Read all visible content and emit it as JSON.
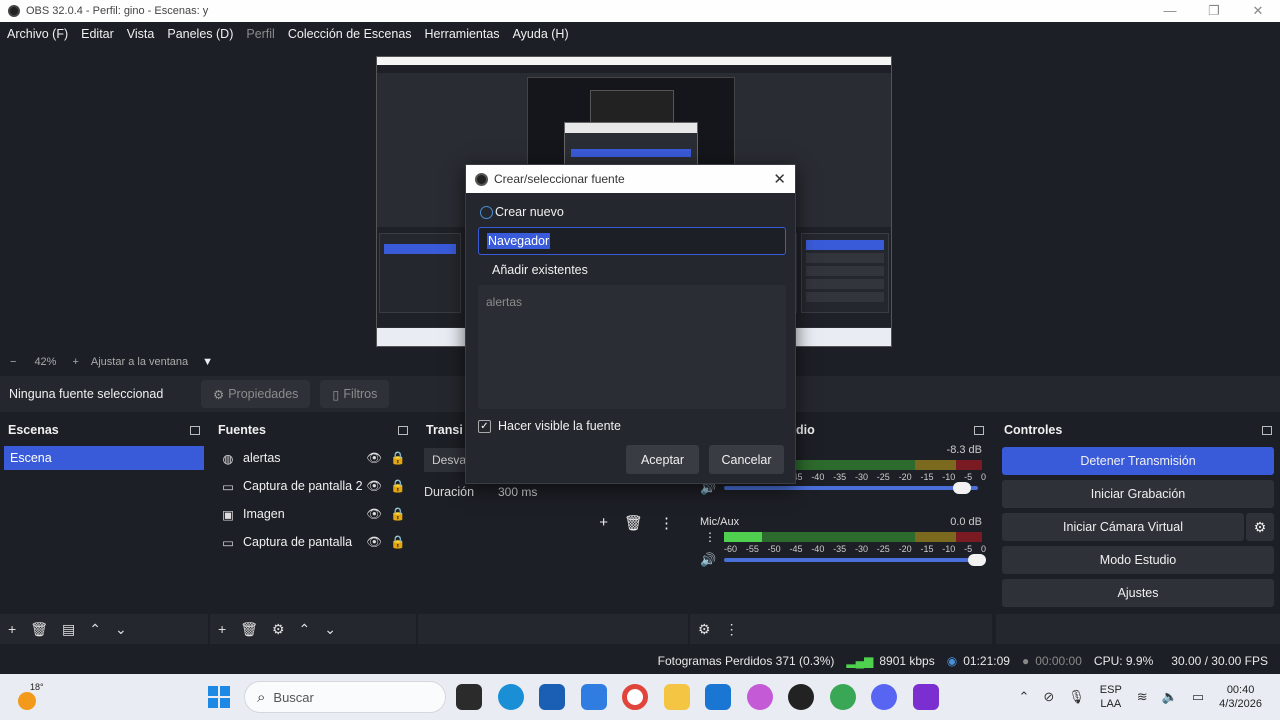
{
  "window": {
    "title": "OBS 32.0.4 - Perfil: gino - Escenas: y",
    "minimize": "—",
    "maximize": "❐",
    "close": "✕"
  },
  "menu": {
    "items": [
      "Archivo (F)",
      "Editar",
      "Vista",
      "Paneles (D)",
      "Perfil",
      "Colección de Escenas",
      "Herramientas",
      "Ayuda (H)"
    ]
  },
  "zoom": {
    "minus": "−",
    "level": "42%",
    "plus": "+",
    "fit_label": "Ajustar a la ventana",
    "dropdown_icon": "▼"
  },
  "source_toolbar": {
    "no_selection": "Ninguna fuente seleccionad",
    "properties": "Propiedades",
    "filters": "Filtros"
  },
  "scenes": {
    "title": "Escenas",
    "items": [
      "Escena"
    ]
  },
  "sources": {
    "title": "Fuentes",
    "items": [
      {
        "label": "alertas",
        "icon": "globe-icon"
      },
      {
        "label": "Captura de pantalla 2",
        "icon": "monitor-icon"
      },
      {
        "label": "Imagen",
        "icon": "image-icon"
      },
      {
        "label": "Captura de pantalla",
        "icon": "monitor-icon"
      }
    ]
  },
  "transitions": {
    "title": "Transi",
    "transition_value": "Desva",
    "duration_label": "Duración",
    "duration_value": "300 ms"
  },
  "mixer": {
    "title": "dio",
    "tracks": [
      {
        "name": "",
        "db": "-8.3 dB",
        "level": 0,
        "volume": 0.94
      },
      {
        "name": "Mic/Aux",
        "db": "0.0 dB",
        "level": 0.2,
        "volume": 1.0
      }
    ],
    "scale": [
      "-60",
      "-55",
      "-50",
      "-45",
      "-40",
      "-35",
      "-30",
      "-25",
      "-20",
      "-15",
      "-10",
      "-5",
      "0"
    ]
  },
  "controls": {
    "title": "Controles",
    "stop_stream": "Detener Transmisión",
    "start_recording": "Iniciar Grabación",
    "start_virtual_cam": "Iniciar Cámara Virtual",
    "studio_mode": "Modo Estudio",
    "settings": "Ajustes"
  },
  "status": {
    "dropped_frames": "Fotogramas Perdidos 371 (0.3%)",
    "bitrate": "8901 kbps",
    "stream_time": "01:21:09",
    "record_time": "00:00:00",
    "cpu": "CPU: 9.9%",
    "fps": "30.00 / 30.00 FPS"
  },
  "dialog": {
    "title": "Crear/seleccionar fuente",
    "create_new": "Crear nuevo",
    "name_value": "Navegador",
    "add_existing": "Añadir existentes",
    "existing_items": [
      "alertas"
    ],
    "make_visible": "Hacer visible la fuente",
    "make_visible_checked": true,
    "ok": "Aceptar",
    "cancel": "Cancelar"
  },
  "taskbar": {
    "temperature": "18°",
    "search_placeholder": "Buscar",
    "language_line1": "ESP",
    "language_line2": "LAA",
    "time": "00:40",
    "date": "4/3/2026",
    "apps": [
      "file-explorer-icon",
      "edge-icon",
      "store-icon",
      "word-icon",
      "chrome-icon",
      "folder-icon",
      "outlook-icon",
      "copilot-icon",
      "obs-icon",
      "chrome-profile-icon",
      "discord-icon",
      "app-icon"
    ]
  },
  "colors": {
    "accent": "#3a5bd9",
    "panel": "#25272e",
    "background": "#1d1f26",
    "meter_green": "#4fd04f"
  }
}
